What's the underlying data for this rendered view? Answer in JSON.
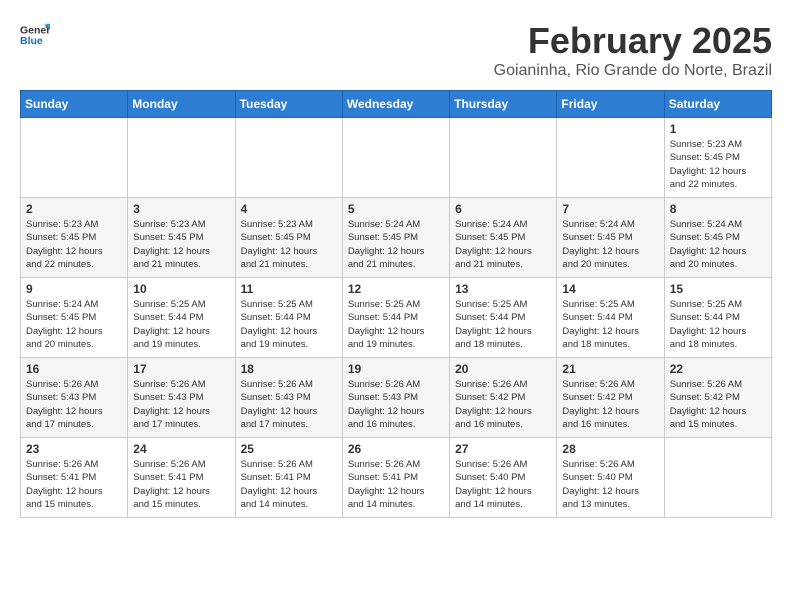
{
  "header": {
    "logo_general": "General",
    "logo_blue": "Blue",
    "month_title": "February 2025",
    "location": "Goianinha, Rio Grande do Norte, Brazil"
  },
  "weekdays": [
    "Sunday",
    "Monday",
    "Tuesday",
    "Wednesday",
    "Thursday",
    "Friday",
    "Saturday"
  ],
  "weeks": [
    [
      {
        "day": "",
        "info": ""
      },
      {
        "day": "",
        "info": ""
      },
      {
        "day": "",
        "info": ""
      },
      {
        "day": "",
        "info": ""
      },
      {
        "day": "",
        "info": ""
      },
      {
        "day": "",
        "info": ""
      },
      {
        "day": "1",
        "info": "Sunrise: 5:23 AM\nSunset: 5:45 PM\nDaylight: 12 hours\nand 22 minutes."
      }
    ],
    [
      {
        "day": "2",
        "info": "Sunrise: 5:23 AM\nSunset: 5:45 PM\nDaylight: 12 hours\nand 22 minutes."
      },
      {
        "day": "3",
        "info": "Sunrise: 5:23 AM\nSunset: 5:45 PM\nDaylight: 12 hours\nand 21 minutes."
      },
      {
        "day": "4",
        "info": "Sunrise: 5:23 AM\nSunset: 5:45 PM\nDaylight: 12 hours\nand 21 minutes."
      },
      {
        "day": "5",
        "info": "Sunrise: 5:24 AM\nSunset: 5:45 PM\nDaylight: 12 hours\nand 21 minutes."
      },
      {
        "day": "6",
        "info": "Sunrise: 5:24 AM\nSunset: 5:45 PM\nDaylight: 12 hours\nand 21 minutes."
      },
      {
        "day": "7",
        "info": "Sunrise: 5:24 AM\nSunset: 5:45 PM\nDaylight: 12 hours\nand 20 minutes."
      },
      {
        "day": "8",
        "info": "Sunrise: 5:24 AM\nSunset: 5:45 PM\nDaylight: 12 hours\nand 20 minutes."
      }
    ],
    [
      {
        "day": "9",
        "info": "Sunrise: 5:24 AM\nSunset: 5:45 PM\nDaylight: 12 hours\nand 20 minutes."
      },
      {
        "day": "10",
        "info": "Sunrise: 5:25 AM\nSunset: 5:44 PM\nDaylight: 12 hours\nand 19 minutes."
      },
      {
        "day": "11",
        "info": "Sunrise: 5:25 AM\nSunset: 5:44 PM\nDaylight: 12 hours\nand 19 minutes."
      },
      {
        "day": "12",
        "info": "Sunrise: 5:25 AM\nSunset: 5:44 PM\nDaylight: 12 hours\nand 19 minutes."
      },
      {
        "day": "13",
        "info": "Sunrise: 5:25 AM\nSunset: 5:44 PM\nDaylight: 12 hours\nand 18 minutes."
      },
      {
        "day": "14",
        "info": "Sunrise: 5:25 AM\nSunset: 5:44 PM\nDaylight: 12 hours\nand 18 minutes."
      },
      {
        "day": "15",
        "info": "Sunrise: 5:25 AM\nSunset: 5:44 PM\nDaylight: 12 hours\nand 18 minutes."
      }
    ],
    [
      {
        "day": "16",
        "info": "Sunrise: 5:26 AM\nSunset: 5:43 PM\nDaylight: 12 hours\nand 17 minutes."
      },
      {
        "day": "17",
        "info": "Sunrise: 5:26 AM\nSunset: 5:43 PM\nDaylight: 12 hours\nand 17 minutes."
      },
      {
        "day": "18",
        "info": "Sunrise: 5:26 AM\nSunset: 5:43 PM\nDaylight: 12 hours\nand 17 minutes."
      },
      {
        "day": "19",
        "info": "Sunrise: 5:26 AM\nSunset: 5:43 PM\nDaylight: 12 hours\nand 16 minutes."
      },
      {
        "day": "20",
        "info": "Sunrise: 5:26 AM\nSunset: 5:42 PM\nDaylight: 12 hours\nand 16 minutes."
      },
      {
        "day": "21",
        "info": "Sunrise: 5:26 AM\nSunset: 5:42 PM\nDaylight: 12 hours\nand 16 minutes."
      },
      {
        "day": "22",
        "info": "Sunrise: 5:26 AM\nSunset: 5:42 PM\nDaylight: 12 hours\nand 15 minutes."
      }
    ],
    [
      {
        "day": "23",
        "info": "Sunrise: 5:26 AM\nSunset: 5:41 PM\nDaylight: 12 hours\nand 15 minutes."
      },
      {
        "day": "24",
        "info": "Sunrise: 5:26 AM\nSunset: 5:41 PM\nDaylight: 12 hours\nand 15 minutes."
      },
      {
        "day": "25",
        "info": "Sunrise: 5:26 AM\nSunset: 5:41 PM\nDaylight: 12 hours\nand 14 minutes."
      },
      {
        "day": "26",
        "info": "Sunrise: 5:26 AM\nSunset: 5:41 PM\nDaylight: 12 hours\nand 14 minutes."
      },
      {
        "day": "27",
        "info": "Sunrise: 5:26 AM\nSunset: 5:40 PM\nDaylight: 12 hours\nand 14 minutes."
      },
      {
        "day": "28",
        "info": "Sunrise: 5:26 AM\nSunset: 5:40 PM\nDaylight: 12 hours\nand 13 minutes."
      },
      {
        "day": "",
        "info": ""
      }
    ]
  ]
}
